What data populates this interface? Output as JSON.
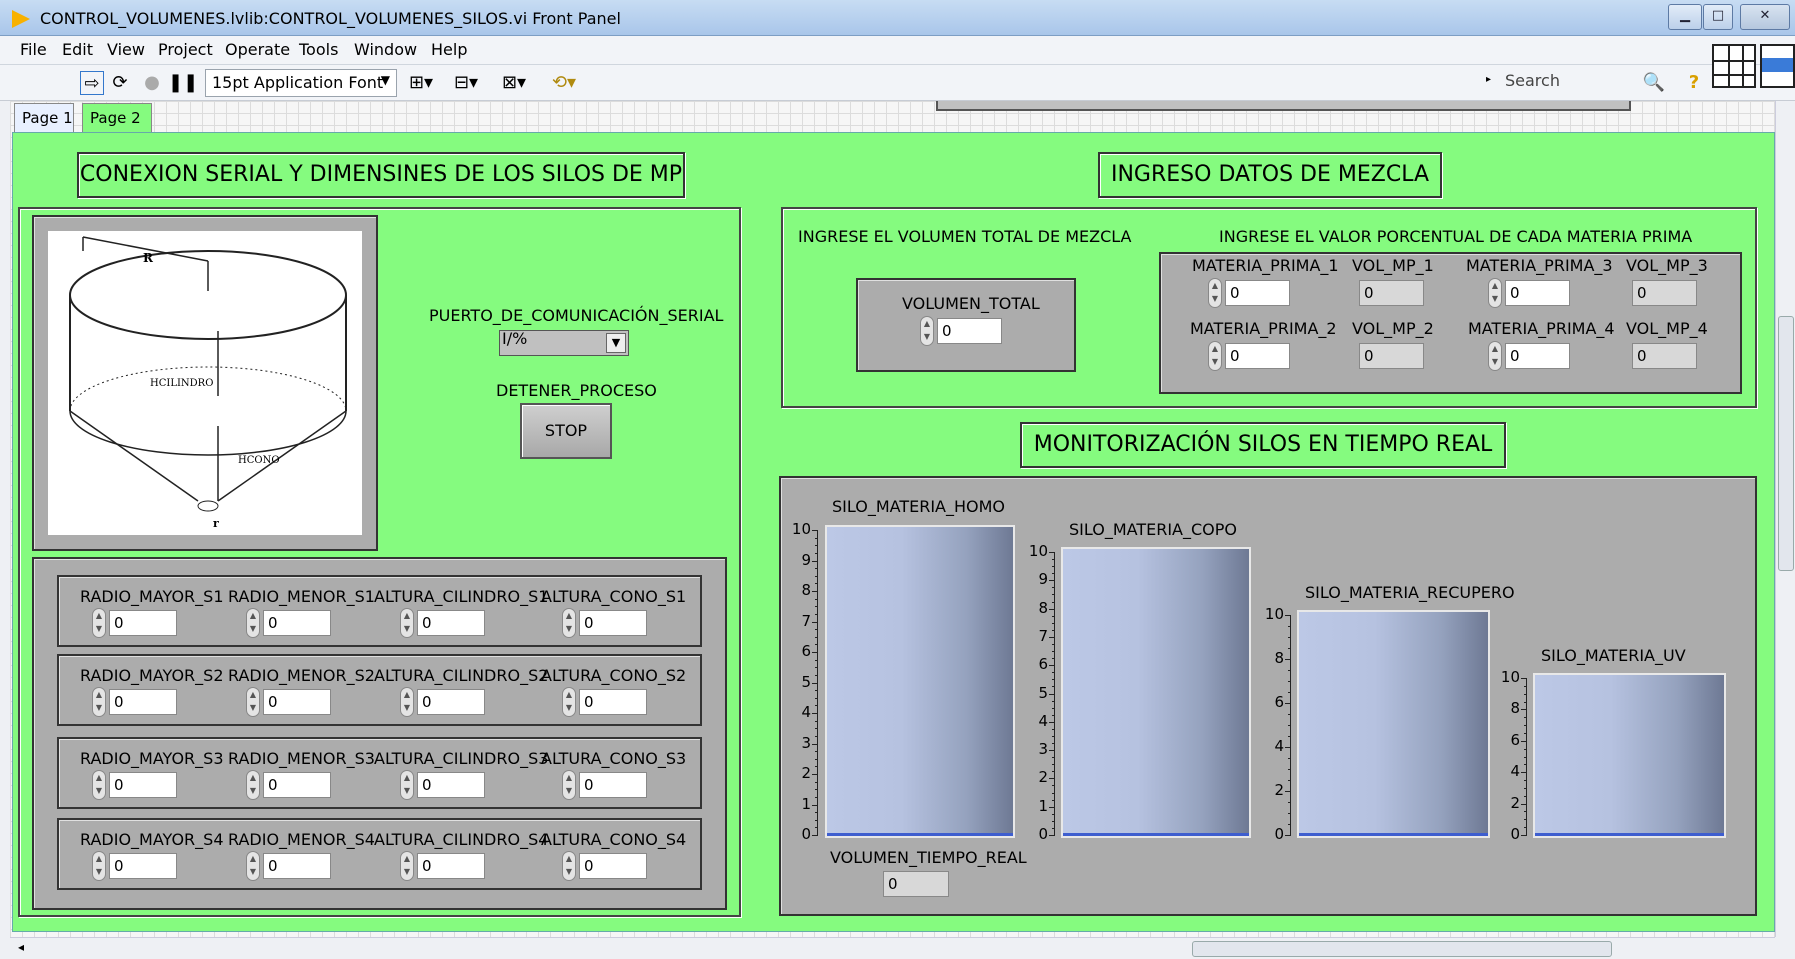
{
  "window": {
    "title": "CONTROL_VOLUMENES.lvlib:CONTROL_VOLUMENES_SILOS.vi Front Panel"
  },
  "menu": [
    "File",
    "Edit",
    "View",
    "Project",
    "Operate",
    "Tools",
    "Window",
    "Help"
  ],
  "toolbar": {
    "font": "15pt Application Font",
    "search_placeholder": "Search"
  },
  "tabs": [
    "Page 1",
    "Page 2"
  ],
  "left": {
    "header": "CONEXION SERIAL Y DIMENSINES DE LOS SILOS DE MP",
    "diagram": {
      "r_top": "R",
      "h_cyl": "HCILINDRO",
      "h_cone": "HCONO",
      "r_bot": "r"
    },
    "serial_label": "PUERTO_DE_COMUNICACIÓN_SERIAL",
    "serial_value": "I/%",
    "stop_label": "DETENER_PROCESO",
    "stop_button": "STOP",
    "silos": [
      {
        "labels": [
          "RADIO_MAYOR_S1",
          "RADIO_MENOR_S1",
          "ALTURA_CILINDRO_S1",
          "ALTURA_CONO_S1"
        ],
        "values": [
          "0",
          "0",
          "0",
          "0"
        ]
      },
      {
        "labels": [
          "RADIO_MAYOR_S2",
          "RADIO_MENOR_S2",
          "ALTURA_CILINDRO_S2",
          "ALTURA_CONO_S2"
        ],
        "values": [
          "0",
          "0",
          "0",
          "0"
        ]
      },
      {
        "labels": [
          "RADIO_MAYOR_S3",
          "RADIO_MENOR_S3",
          "ALTURA_CILINDRO_S3",
          "ALTURA_CONO_S3"
        ],
        "values": [
          "0",
          "0",
          "0",
          "0"
        ]
      },
      {
        "labels": [
          "RADIO_MAYOR_S4",
          "RADIO_MENOR_S4",
          "ALTURA_CILINDRO_S4",
          "ALTURA_CONO_S4"
        ],
        "values": [
          "0",
          "0",
          "0",
          "0"
        ]
      }
    ]
  },
  "mezcla": {
    "header": "INGRESO DATOS DE MEZCLA",
    "vol_total_caption": "INGRESE EL VOLUMEN TOTAL DE MEZCLA",
    "vol_total_label": "VOLUMEN_TOTAL",
    "vol_total_value": "0",
    "pct_caption": "INGRESE EL VALOR PORCENTUAL DE CADA MATERIA PRIMA",
    "mp": [
      {
        "label": "MATERIA_PRIMA_1",
        "value": "0",
        "vol_label": "VOL_MP_1",
        "vol_value": "0"
      },
      {
        "label": "MATERIA_PRIMA_2",
        "value": "0",
        "vol_label": "VOL_MP_2",
        "vol_value": "0"
      },
      {
        "label": "MATERIA_PRIMA_3",
        "value": "0",
        "vol_label": "VOL_MP_3",
        "vol_value": "0"
      },
      {
        "label": "MATERIA_PRIMA_4",
        "value": "0",
        "vol_label": "VOL_MP_4",
        "vol_value": "0"
      }
    ]
  },
  "monitor": {
    "header": "MONITORIZACIÓN SILOS EN TIEMPO REAL",
    "tanks": [
      {
        "name": "SILO_MATERIA_HOMO",
        "ticks": [
          "10",
          "9",
          "8",
          "7",
          "6",
          "5",
          "4",
          "3",
          "2",
          "1",
          "0"
        ]
      },
      {
        "name": "SILO_MATERIA_COPO",
        "ticks": [
          "10",
          "9",
          "8",
          "7",
          "6",
          "5",
          "4",
          "3",
          "2",
          "1",
          "0"
        ]
      },
      {
        "name": "SILO_MATERIA_RECUPERO",
        "ticks": [
          "10",
          "8",
          "6",
          "4",
          "2",
          "0"
        ]
      },
      {
        "name": "SILO_MATERIA_UV",
        "ticks": [
          "10",
          "8",
          "6",
          "4",
          "2",
          "0"
        ]
      }
    ],
    "tank_levels": [
      0,
      0,
      0,
      0
    ],
    "vol_real_label": "VOLUMEN_TIEMPO_REAL",
    "vol_real_value": "0"
  },
  "colors": {
    "panel": "#85fb7f",
    "tank_fill_line": "#3e5ecf"
  }
}
